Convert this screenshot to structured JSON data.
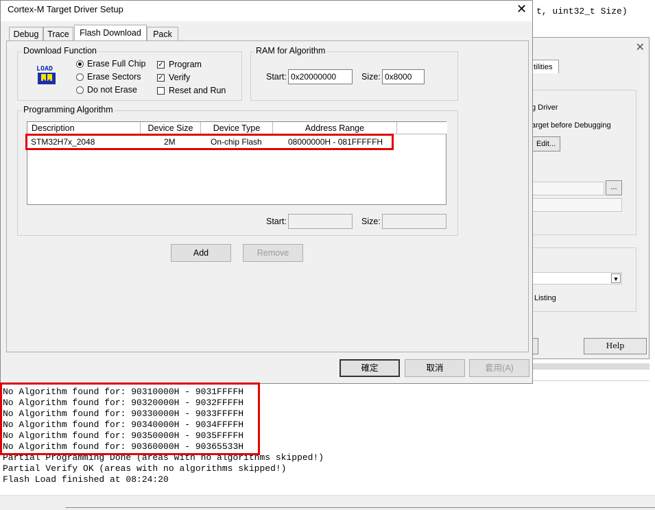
{
  "background_code": "t, uint32_t Size)",
  "back_dialog": {
    "tab_label": "tilities",
    "text_driver": "g Driver",
    "text_target": "arget before Debugging",
    "edit_button": "Edit...",
    "browse_button": "...",
    "listing_text": "Listing",
    "help_button": "Help"
  },
  "dialog": {
    "title": "Cortex-M Target Driver Setup",
    "close_glyph": "✕",
    "tabs": [
      "Debug",
      "Trace",
      "Flash Download",
      "Pack"
    ],
    "active_tab": "Flash Download",
    "download_function": {
      "label": "Download Function",
      "icon_text": "LOAD",
      "radios": [
        {
          "label": "Erase Full Chip",
          "selected": true
        },
        {
          "label": "Erase Sectors",
          "selected": false
        },
        {
          "label": "Do not Erase",
          "selected": false
        }
      ],
      "checks": [
        {
          "label": "Program",
          "checked": true
        },
        {
          "label": "Verify",
          "checked": true
        },
        {
          "label": "Reset and Run",
          "checked": false
        }
      ]
    },
    "ram": {
      "label": "RAM for Algorithm",
      "start_label": "Start:",
      "start_value": "0x20000000",
      "size_label": "Size:",
      "size_value": "0x8000"
    },
    "programming_algorithm": {
      "label": "Programming Algorithm",
      "columns": [
        "Description",
        "Device Size",
        "Device Type",
        "Address Range"
      ],
      "rows": [
        {
          "description": "STM32H7x_2048",
          "device_size": "2M",
          "device_type": "On-chip Flash",
          "address_range": "08000000H - 081FFFFFH"
        }
      ],
      "start_label": "Start:",
      "start_value": "",
      "size_label": "Size:",
      "size_value": ""
    },
    "add_button": "Add",
    "remove_button": "Remove",
    "ok_button": "確定",
    "cancel_button": "取消",
    "apply_button": "套用(A)"
  },
  "log_lines": [
    "No Algorithm found for: 90310000H - 9031FFFFH",
    "No Algorithm found for: 90320000H - 9032FFFFH",
    "No Algorithm found for: 90330000H - 9033FFFFH",
    "No Algorithm found for: 90340000H - 9034FFFFH",
    "No Algorithm found for: 90350000H - 9035FFFFH",
    "No Algorithm found for: 90360000H - 90365533H",
    "Partial Programming Done (areas with no algorithms skipped!)",
    "Partial Verify OK (areas with no algorithms skipped!)",
    "Flash Load finished at 08:24:20"
  ],
  "colors": {
    "highlight": "#e00000",
    "dialog_bg": "#f0f0f0",
    "load_icon": "#1a2fb0"
  }
}
